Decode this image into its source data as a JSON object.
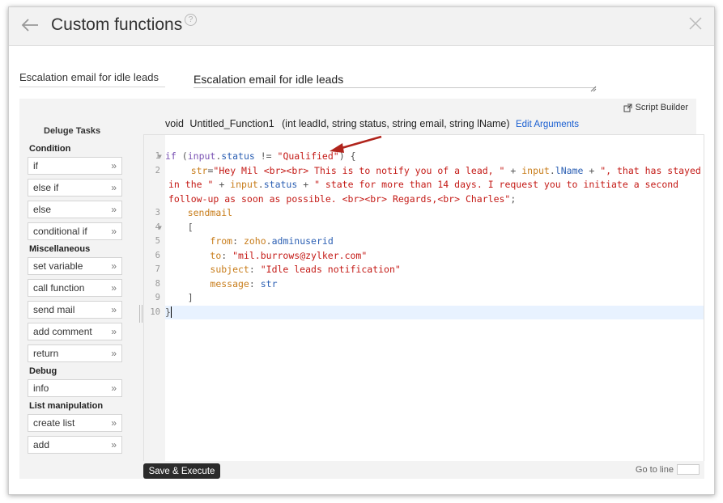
{
  "header": {
    "title": "Custom functions",
    "help_symbol": "?"
  },
  "function_name": {
    "label": "Escalation email for idle leads",
    "value": "Escalation email for idle leads"
  },
  "toolbar": {
    "script_builder_label": "Script Builder"
  },
  "signature": {
    "return_type": "void",
    "name": "Untitled_Function1",
    "params": "(int leadId, string status, string email, string lName)",
    "edit_arguments_label": "Edit Arguments"
  },
  "tasks": {
    "heading": "Deluge Tasks",
    "sections": [
      {
        "title": "Condition",
        "items": [
          "if",
          "else if",
          "else",
          "conditional if"
        ]
      },
      {
        "title": "Miscellaneous",
        "items": [
          "set variable",
          "call function",
          "send mail",
          "add comment",
          "return"
        ]
      },
      {
        "title": "Debug",
        "items": [
          "info"
        ]
      },
      {
        "title": "List manipulation",
        "items": [
          "create list",
          "add"
        ]
      }
    ]
  },
  "code": {
    "line_numbers": [
      "1",
      "2",
      "3",
      "4",
      "5",
      "6",
      "7",
      "8",
      "9",
      "10"
    ],
    "if_kw": "if",
    "l1_open": " (",
    "l1_obj": "input",
    "l1_dot": ".",
    "l1_field": "status",
    "l1_op": " != ",
    "l1_str": "\"Qualified\"",
    "l1_close": ")",
    "l1_brace": " {",
    "l2_var": "str",
    "l2_eq": "=",
    "l2_s1": "\"Hey Mil <br><br> This is to notify you of a lead, \"",
    "l2_plus1": " + ",
    "l2_obj1": "input",
    "l2_dot1": ".",
    "l2_field1": "lName",
    "l2_plus2": " + ",
    "l2_s2": "\", that has stayed in the \"",
    "l2_plus3": " + ",
    "l2_obj2": "input",
    "l2_dot2": ".",
    "l2_field2": "status",
    "l2_plus4": " + ",
    "l2_s3": "\" state for more than 14 days. I request you to initiate a second follow-up as soon as possible. <br><br> Regards,<br> Charles\"",
    "l2_semi": ";",
    "l3_kw": "sendmail",
    "l4": "[",
    "l5_key": "from",
    "l5_colon": ": ",
    "l5_obj": "zoho",
    "l5_dot": ".",
    "l5_field": "adminuserid",
    "l6_key": "to",
    "l6_colon": ": ",
    "l6_str": "\"mil.burrows@zylker.com\"",
    "l7_key": "subject",
    "l7_colon": ": ",
    "l7_str": "\"Idle leads notification\"",
    "l8_key": "message",
    "l8_colon": ": ",
    "l8_var": "str",
    "l9": "]",
    "l10": "}"
  },
  "footer": {
    "save_label": "Save & Execute",
    "goto_label": "Go to line",
    "goto_value": ""
  },
  "colors": {
    "keyword": "#7a52b3",
    "string": "#c41a16",
    "variable": "#2b5fb3",
    "key": "#c87d1b",
    "annotation_arrow": "#b0241c"
  }
}
